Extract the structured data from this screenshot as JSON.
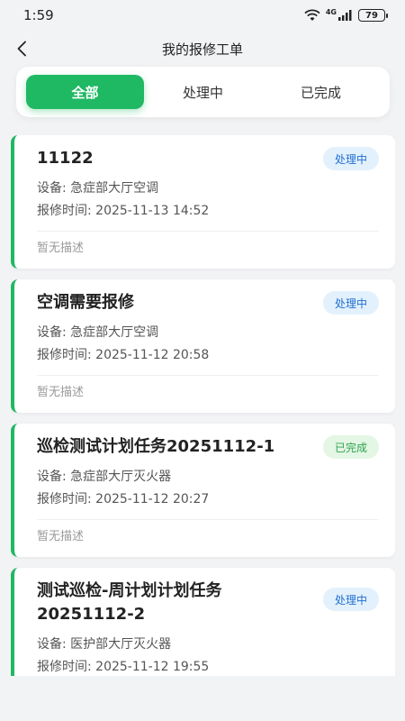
{
  "status_bar": {
    "time": "1:59",
    "network": "4G",
    "battery": "79"
  },
  "header": {
    "title": "我的报修工单"
  },
  "tabs": [
    {
      "label": "全部",
      "active": true
    },
    {
      "label": "处理中",
      "active": false
    },
    {
      "label": "已完成",
      "active": false
    }
  ],
  "cards": [
    {
      "title": "11122",
      "status": "处理中",
      "equipment_label": "设备: ",
      "equipment": "急症部大厅空调",
      "time_label": "报修时间: ",
      "time": "2025-11-13 14:52",
      "description": "暂无描述"
    },
    {
      "title": "空调需要报修",
      "status": "处理中",
      "equipment_label": "设备: ",
      "equipment": "急症部大厅空调",
      "time_label": "报修时间: ",
      "time": "2025-11-12 20:58",
      "description": "暂无描述"
    },
    {
      "title": "巡检测试计划任务20251112-1",
      "status": "已完成",
      "equipment_label": "设备: ",
      "equipment": "急症部大厅灭火器",
      "time_label": "报修时间: ",
      "time": "2025-11-12 20:27",
      "description": "暂无描述"
    },
    {
      "title": "测试巡检-周计划计划任务20251112-2",
      "status": "处理中",
      "equipment_label": "设备: ",
      "equipment": "医护部大厅灭火器",
      "time_label": "报修时间: ",
      "time": "2025-11-12 19:55",
      "description": ""
    }
  ],
  "colors": {
    "accent": "#1fb863",
    "processing_badge_bg": "#e3f1fd",
    "processing_badge_text": "#1f6fd1",
    "done_badge_bg": "#e4f6e4",
    "done_badge_text": "#2ea44f"
  }
}
